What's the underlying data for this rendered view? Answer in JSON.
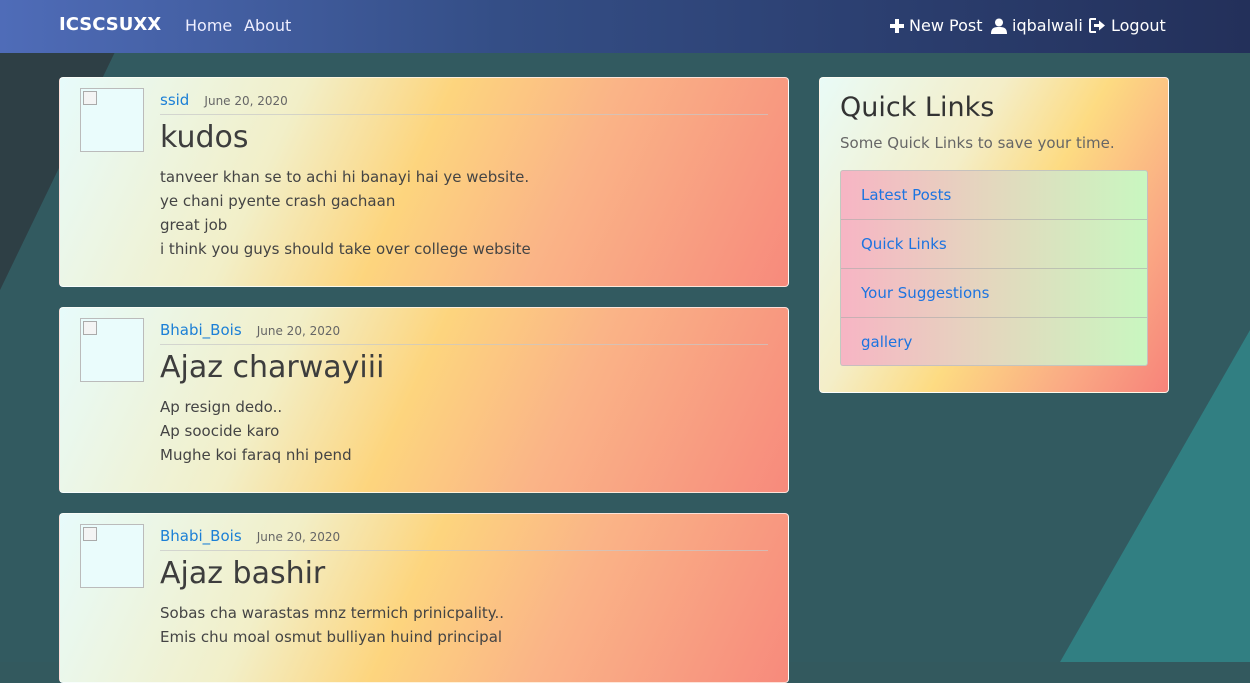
{
  "navbar": {
    "brand": "ICSCSUXX",
    "home": "Home",
    "about": "About",
    "new_post": "New Post",
    "username": "iqbalwali",
    "logout": "Logout"
  },
  "posts": [
    {
      "author": "ssid",
      "date": "June 20, 2020",
      "title": "kudos",
      "lines": [
        "tanveer khan se to achi hi banayi hai ye website.",
        "ye chani pyente crash gachaan",
        "great job",
        "i think you guys should take over college website"
      ]
    },
    {
      "author": "Bhabi_Bois",
      "date": "June 20, 2020",
      "title": "Ajaz charwayiii",
      "lines": [
        "Ap resign dedo..",
        "Ap soocide karo",
        "Mughe koi faraq nhi pend"
      ]
    },
    {
      "author": "Bhabi_Bois",
      "date": "June 20, 2020",
      "title": "Ajaz bashir",
      "lines": [
        "Sobas cha warastas mnz termich prinicpality..",
        "Emis chu moal osmut bulliyan huind principal"
      ]
    }
  ],
  "sidebar": {
    "title": "Quick Links",
    "subtitle": "Some Quick Links to save your time.",
    "links": [
      "Latest Posts",
      "Quick Links",
      "Your Suggestions",
      "gallery"
    ]
  },
  "icons": {
    "new_post": "plus-icon",
    "user": "user-icon",
    "logout": "sign-out-icon"
  },
  "colors": {
    "navbar_start": "#4f6cb8",
    "navbar_end": "#23305a",
    "link": "#1d74e0",
    "background": "#33595e"
  }
}
